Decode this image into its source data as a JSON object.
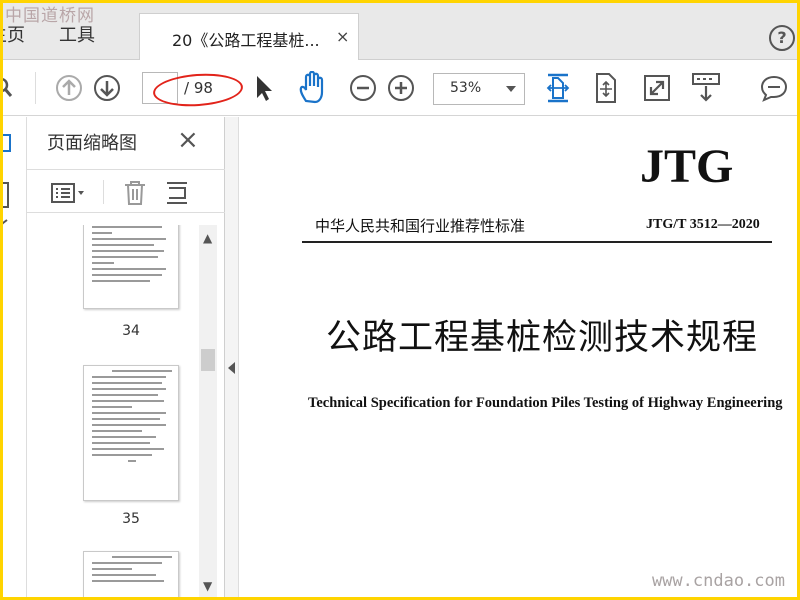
{
  "watermarks": {
    "top": "中国道桥网",
    "bottom": "www.cndao.com"
  },
  "menu": {
    "home": "主页",
    "tools": "工具"
  },
  "tab": {
    "title": "20《公路工程基桩...",
    "close": "×"
  },
  "help": "?",
  "toolbar": {
    "current_page": "",
    "page_total": "/ 98",
    "zoom": "53%",
    "colors": {
      "accent": "#1a73c9",
      "annotation": "#e2231a"
    },
    "icons": [
      "search-icon",
      "prev-page-icon",
      "next-page-icon",
      "select-cursor-icon",
      "hand-icon",
      "zoom-out-icon",
      "zoom-in-icon",
      "fit-page-icon",
      "fit-width-icon",
      "fullscreen-icon",
      "scroll-mode-icon",
      "comment-icon"
    ]
  },
  "panel": {
    "title": "页面缩略图",
    "close": "×",
    "thumbnails": [
      {
        "page": "34"
      },
      {
        "page": "35"
      }
    ]
  },
  "document": {
    "logo": "JTG",
    "standard_type": "中华人民共和国行业推荐性标准",
    "code": "JTG/T 3512—2020",
    "title_cn": "公路工程基桩检测技术规程",
    "title_en": "Technical Specification for Foundation Piles Testing of Highway Engineering"
  }
}
